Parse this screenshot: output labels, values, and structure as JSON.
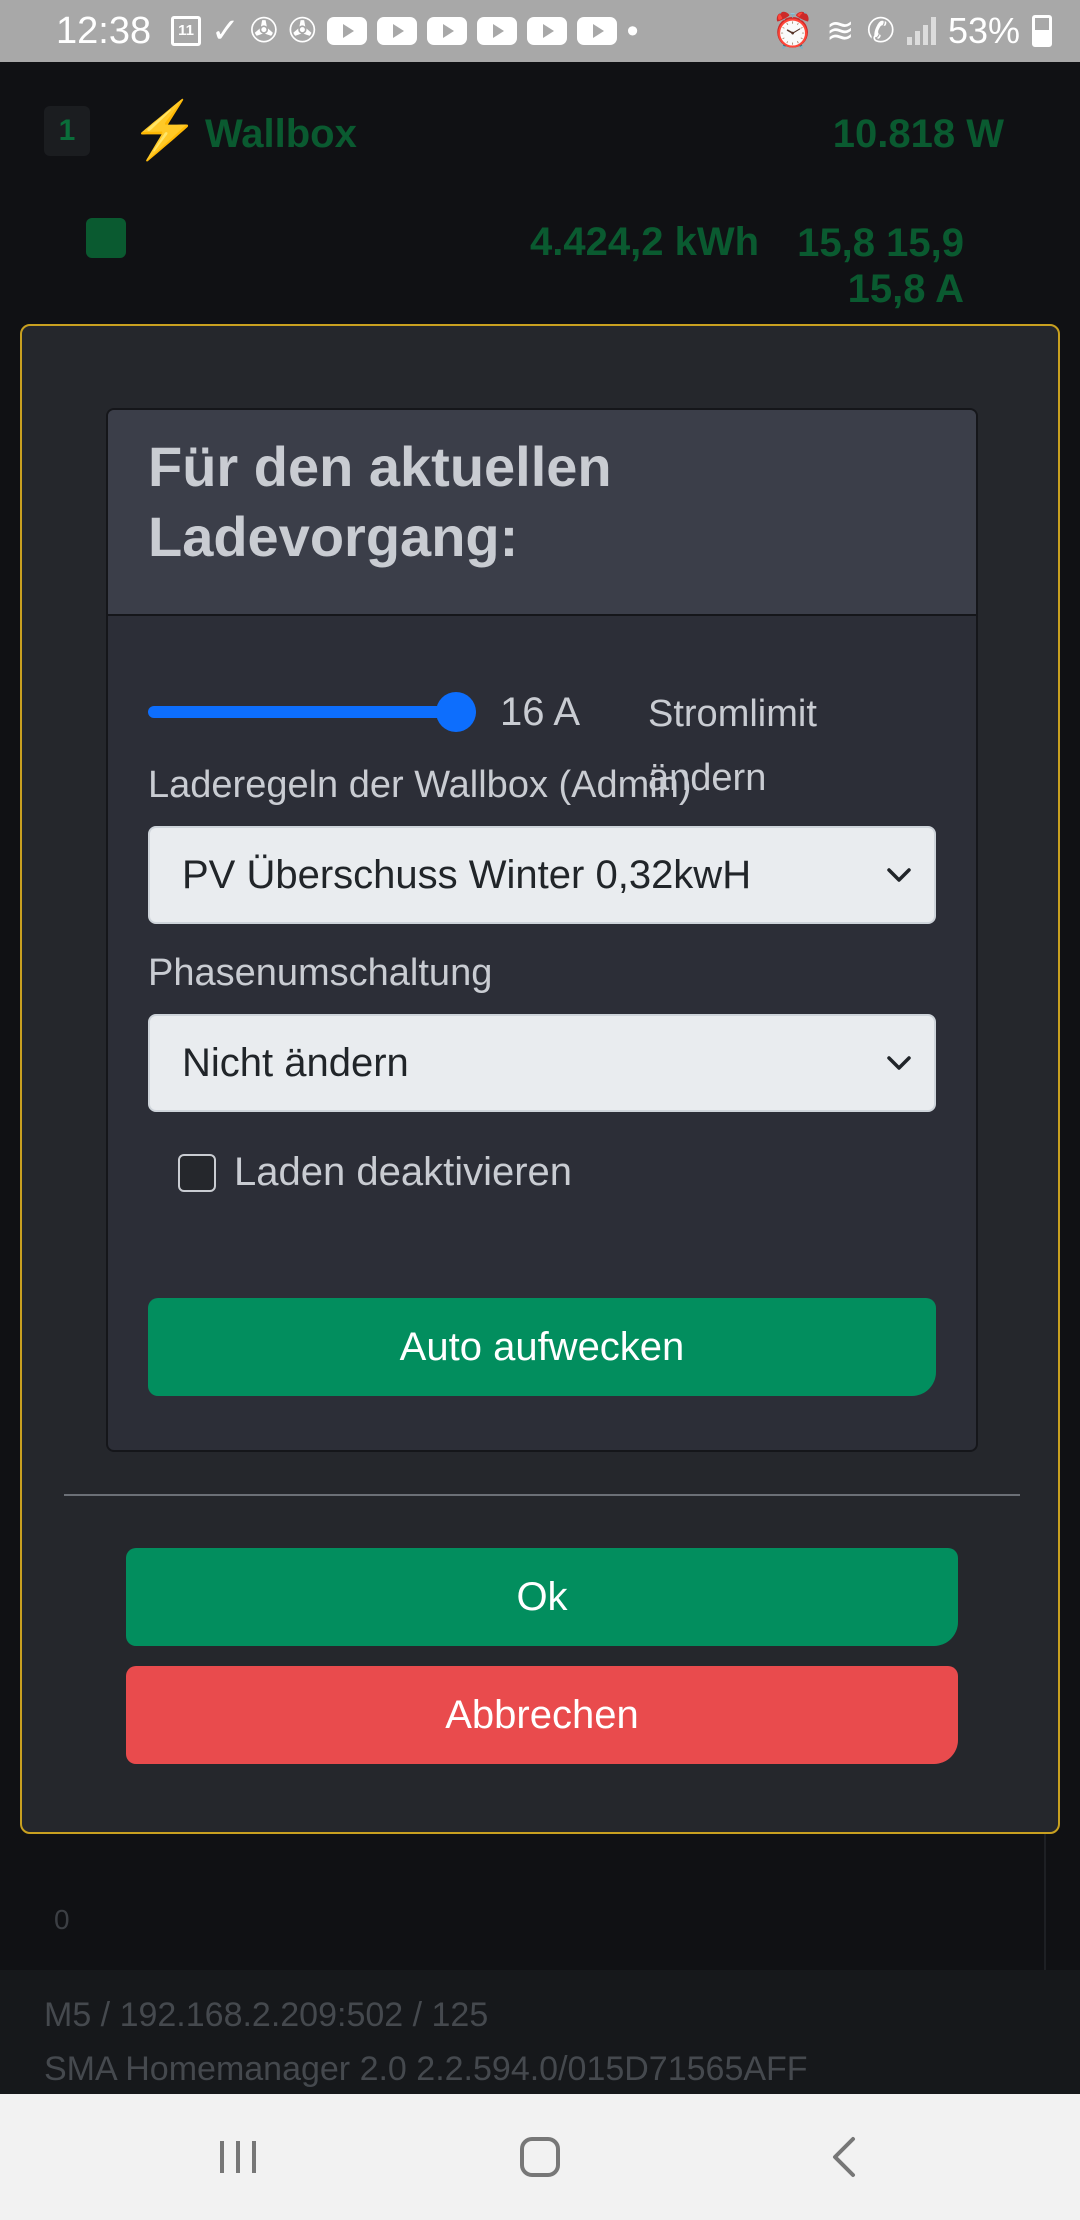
{
  "status_bar": {
    "time": "12:38",
    "calendar_day": "11",
    "battery": "53%",
    "battery_level": 0.53
  },
  "background": {
    "badge": "1",
    "device_name": "Wallbox",
    "power": "10.818 W",
    "energy": "4.424,2 kWh",
    "currents_line1": "15,8 15,9",
    "currents_line2": "15,8 A",
    "counter": "0",
    "footer_line1": "M5 / 192.168.2.209:502 / 125",
    "footer_line2": "SMA Homemanager 2.0 2.2.594.0/015D71565AFF",
    "accent_color": "#0a5a30"
  },
  "dialog": {
    "title": "Für den aktuellen Ladevorgang:",
    "slider": {
      "value": 16,
      "value_label": "16 A",
      "label": "Stromlimit ändern",
      "min": 6,
      "max": 16
    },
    "rules_label": "Laderegeln der Wallbox (Admin)",
    "rules_selected": "PV Überschuss Winter 0,32kwH",
    "phase_label": "Phasenumschaltung",
    "phase_selected": "Nicht ändern",
    "disable_label": "Laden deaktivieren",
    "disable_checked": false,
    "wake_button": "Auto aufwecken",
    "ok_button": "Ok",
    "cancel_button": "Abbrechen",
    "colors": {
      "primary": "#028e5e",
      "danger": "#e94b4d",
      "slider": "#0d6efd",
      "border": "#c8a020"
    }
  },
  "nav_bar": {
    "recent": "recent-apps-icon",
    "home": "home-icon",
    "back": "back-icon"
  }
}
